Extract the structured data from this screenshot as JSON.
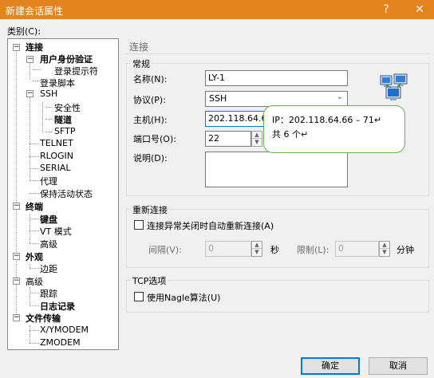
{
  "window": {
    "title": "新建会话属性",
    "help_label": "?",
    "close_label": "✕"
  },
  "category_label": "类别(C):",
  "tree": [
    {
      "label": "连接",
      "bold": true,
      "pm": "−"
    },
    {
      "label": "用户身份验证",
      "bold": true,
      "pm": "−"
    },
    {
      "label": "登录提示符",
      "bold": false
    },
    {
      "label": "登录脚本",
      "bold": false
    },
    {
      "label": "SSH",
      "bold": false,
      "pm": "−"
    },
    {
      "label": "安全性",
      "bold": false
    },
    {
      "label": "隧道",
      "bold": true
    },
    {
      "label": "SFTP",
      "bold": false
    },
    {
      "label": "TELNET",
      "bold": false
    },
    {
      "label": "RLOGIN",
      "bold": false
    },
    {
      "label": "SERIAL",
      "bold": false
    },
    {
      "label": "代理",
      "bold": false
    },
    {
      "label": "保持活动状态",
      "bold": false
    },
    {
      "label": "终端",
      "bold": true,
      "pm": "−"
    },
    {
      "label": "键盘",
      "bold": true
    },
    {
      "label": "VT 模式",
      "bold": false
    },
    {
      "label": "高级",
      "bold": false
    },
    {
      "label": "外观",
      "bold": true,
      "pm": "−"
    },
    {
      "label": "边距",
      "bold": false
    },
    {
      "label": "高级",
      "bold": false,
      "pm": "−"
    },
    {
      "label": "跟踪",
      "bold": false
    },
    {
      "label": "日志记录",
      "bold": true
    },
    {
      "label": "文件传输",
      "bold": true,
      "pm": "−"
    },
    {
      "label": "X/YMODEM",
      "bold": false
    },
    {
      "label": "ZMODEM",
      "bold": false
    }
  ],
  "panel": {
    "heading": "连接",
    "general": {
      "title": "常规",
      "name_label": "名称(N):",
      "name_value": "LY-1",
      "protocol_label": "协议(P):",
      "protocol_value": "SSH",
      "host_label": "主机(H):",
      "host_value": "202.118.64.6",
      "port_label": "端口号(O):",
      "port_value": "22",
      "desc_label": "说明(D):",
      "desc_value": ""
    },
    "reconnect": {
      "title": "重新连接",
      "auto_label": "连接异常关闭时自动重新连接(A)",
      "interval_label": "间隔(V):",
      "interval_value": "0",
      "seconds_label": "秒",
      "limit_label": "限制(L):",
      "limit_value": "0",
      "minutes_label": "分钟"
    },
    "tcp": {
      "title": "TCP选项",
      "nagle_label": "使用Nagle算法(U)"
    }
  },
  "tooltip": {
    "line1": "IP：202.118.64.66 – 71↵",
    "line2": "共 6 个↵"
  },
  "buttons": {
    "ok": "确定",
    "cancel": "取消"
  }
}
